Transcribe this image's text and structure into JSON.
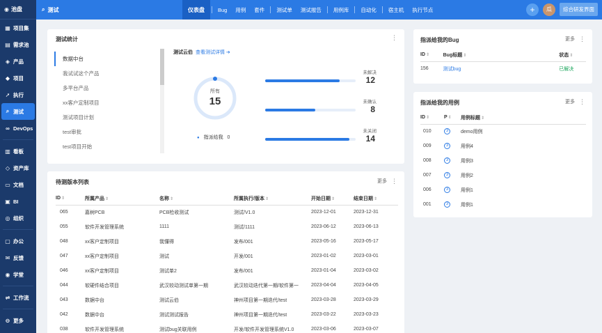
{
  "sidebar": {
    "logo": "池盘",
    "items": [
      {
        "label": "项目集",
        "icon": "folder-icon"
      },
      {
        "label": "需求池",
        "icon": "inbox-icon"
      },
      {
        "label": "产品",
        "icon": "product-icon"
      },
      {
        "label": "项目",
        "icon": "project-icon"
      },
      {
        "label": "执行",
        "icon": "execute-icon"
      },
      {
        "label": "测试",
        "icon": "test-icon",
        "active": true
      },
      {
        "label": "DevOps",
        "icon": "devops-icon"
      },
      {
        "label": "看板",
        "icon": "kanban-icon"
      },
      {
        "label": "资产库",
        "icon": "asset-icon"
      },
      {
        "label": "文档",
        "icon": "doc-icon"
      },
      {
        "label": "BI",
        "icon": "bi-icon"
      },
      {
        "label": "组织",
        "icon": "org-icon"
      },
      {
        "label": "办公",
        "icon": "office-icon"
      },
      {
        "label": "反馈",
        "icon": "feedback-icon"
      },
      {
        "label": "学堂",
        "icon": "school-icon"
      },
      {
        "label": "工作流",
        "icon": "workflow-icon"
      },
      {
        "label": "更多",
        "icon": "more-icon"
      }
    ]
  },
  "topbar": {
    "title": "测试",
    "tabs": [
      "仪表盘",
      "Bug",
      "用例",
      "套件",
      "测试单",
      "测试报告",
      "用例库",
      "自动化",
      "宿主机",
      "执行节点"
    ],
    "avatar": "瓜",
    "switch_label": "综合研发界面"
  },
  "stats": {
    "title": "测试统计",
    "list": [
      "数据中台",
      "我试试这个产品",
      "多平台产品",
      "xx客户定制项目",
      "测试项目计划",
      "test审批",
      "test项目开始"
    ],
    "subtitle": "测试云伯",
    "link": "查看测试详情",
    "total_label": "所有",
    "total": "15",
    "assigned_label": "指派给我",
    "assigned_value": "0",
    "metrics": [
      {
        "label": "未解决",
        "value": "12",
        "ratio": 0.82
      },
      {
        "label": "未确认",
        "value": "8",
        "ratio": 0.55
      },
      {
        "label": "未关闭",
        "value": "14",
        "ratio": 0.93
      }
    ]
  },
  "releases": {
    "title": "待测版本列表",
    "more": "更多",
    "columns": [
      "ID",
      "所属产品",
      "名称",
      "所属执行/版本",
      "开始日期",
      "结束日期"
    ],
    "rows": [
      [
        "065",
        "嘉树PCB",
        "PCB检收测试",
        "测试/V1.0",
        "2023-12-01",
        "2023-12-31"
      ],
      [
        "055",
        "软件开发管理系统",
        "1111",
        "测试/1111",
        "2023-06-12",
        "2023-06-13"
      ],
      [
        "048",
        "xx客户定制项目",
        "我懂得",
        "发布/001",
        "2023-05-16",
        "2023-05-17"
      ],
      [
        "047",
        "xx客户定制项目",
        "测试",
        "开发/001",
        "2023-01-02",
        "2023-03-01"
      ],
      [
        "046",
        "xx客户定制项目",
        "测试单2",
        "发布/001",
        "2023-01-04",
        "2023-03-02"
      ],
      [
        "044",
        "软硬件结合项目",
        "武汉较动测试单第一期",
        "武汉较动迭代第一期/软件第一",
        "2023-04-04",
        "2023-04-05"
      ],
      [
        "043",
        "数据中台",
        "测试云伯",
        "神州项目第一期迭代/test",
        "2023-03-28",
        "2023-03-29"
      ],
      [
        "042",
        "数据中台",
        "测试测试报告",
        "神州项目第一期迭代/test",
        "2023-03-22",
        "2023-03-23"
      ],
      [
        "038",
        "软件开发管理系统",
        "测试bug关联用例",
        "开发/软件开发管理系统V1.0",
        "2023-03-06",
        "2023-03-07"
      ]
    ]
  },
  "bugs": {
    "title": "指派给我的Bug",
    "more": "更多",
    "columns": [
      "ID",
      "Bug标题",
      "状态"
    ],
    "rows": [
      [
        "156",
        "测试bug",
        "已解决"
      ]
    ]
  },
  "cases": {
    "title": "指派给我的用例",
    "more": "更多",
    "columns": [
      "ID",
      "P",
      "用例标题"
    ],
    "rows": [
      [
        "010",
        "3",
        "demo用例"
      ],
      [
        "009",
        "3",
        "用例4"
      ],
      [
        "008",
        "3",
        "用例3"
      ],
      [
        "007",
        "3",
        "用例2"
      ],
      [
        "006",
        "3",
        "用例1"
      ],
      [
        "001",
        "3",
        "用例1"
      ]
    ]
  },
  "colors": {
    "primary": "#2b7ae4",
    "sidebar": "#1b3a6b",
    "success": "#19a55a"
  }
}
